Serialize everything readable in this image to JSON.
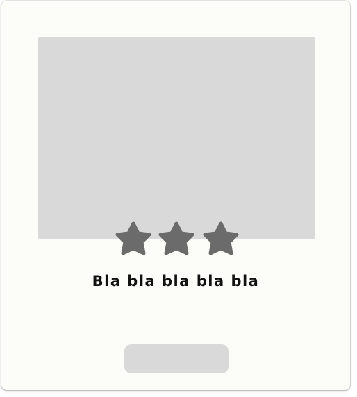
{
  "card": {
    "caption": "Bla bla bla bla bla",
    "button_label": "",
    "rating": {
      "value": 3,
      "icon": "star-icon",
      "color": "#6b6b6b"
    }
  },
  "colors": {
    "card_background": "#fcfcf8",
    "placeholder": "#d9d9d9"
  }
}
